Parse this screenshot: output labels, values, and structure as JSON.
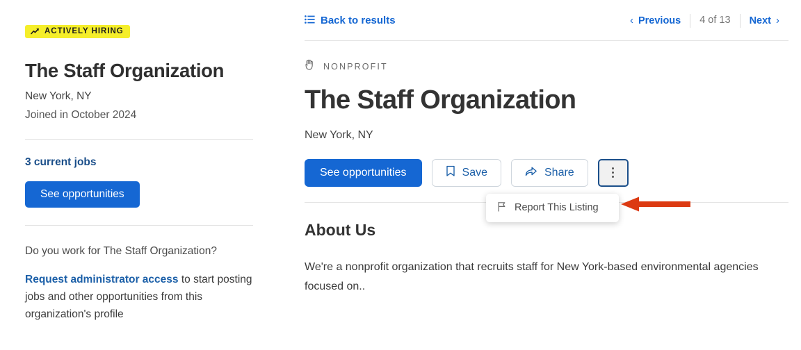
{
  "sidebar": {
    "badge": {
      "label": "ACTIVELY HIRING",
      "icon": "trending-up-icon",
      "bg": "#f5ee2a"
    },
    "org_name": "The Staff Organization",
    "location": "New York, NY",
    "joined": "Joined in October 2024",
    "jobs_link": "3 current jobs",
    "see_opportunities": "See opportunities",
    "work_question": "Do you work for The Staff Organization?",
    "admin_link": "Request administrator access",
    "admin_rest": " to start posting jobs and other opportunities from this organization's profile"
  },
  "main": {
    "back_label": "Back to results",
    "back_icon": "list-icon",
    "pager": {
      "previous": "Previous",
      "next": "Next",
      "count": "4 of 13",
      "prev_icon": "chevron-left-icon",
      "next_icon": "chevron-right-icon"
    },
    "category": "NONPROFIT",
    "category_icon": "helping-hand-icon",
    "title": "The Staff Organization",
    "location": "New York, NY",
    "actions": {
      "see_opportunities": "See opportunities",
      "save": "Save",
      "save_icon": "bookmark-icon",
      "share": "Share",
      "share_icon": "share-arrow-icon",
      "more_icon": "kebab-menu-icon"
    },
    "dropdown": {
      "report": "Report This Listing",
      "report_icon": "flag-icon"
    },
    "about_heading": "About Us",
    "about_body": "We're a nonprofit organization that recruits staff for New York-based environmental agencies focused on..",
    "annotation": {
      "icon": "red-arrow-left-icon",
      "color": "#dc3a12"
    }
  },
  "colors": {
    "accent": "#1567d3",
    "link": "#1b5fa8",
    "text": "#333333"
  }
}
